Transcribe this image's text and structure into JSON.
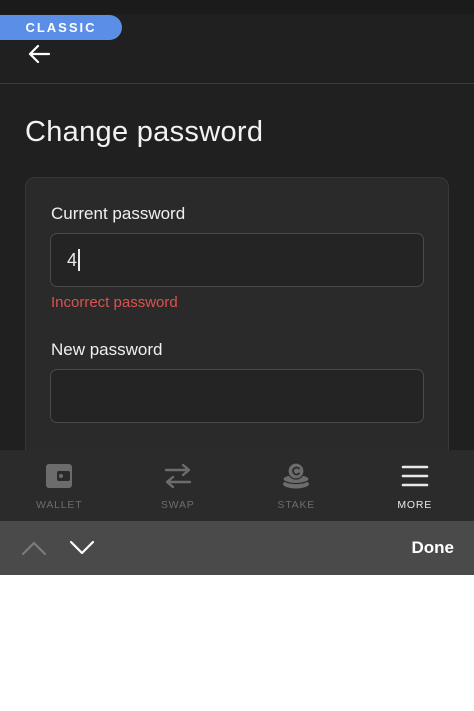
{
  "badge": {
    "label": "CLASSIC"
  },
  "header": {
    "back_icon": "arrow-left-icon"
  },
  "page": {
    "title": "Change password"
  },
  "form": {
    "current_label": "Current password",
    "current_value": "4",
    "error": "Incorrect password",
    "new_label": "New password",
    "new_value": ""
  },
  "nav": {
    "items": [
      {
        "label": "WALLET",
        "icon": "wallet-icon",
        "active": false
      },
      {
        "label": "SWAP",
        "icon": "swap-arrows-icon",
        "active": false
      },
      {
        "label": "STAKE",
        "icon": "coin-stack-icon",
        "active": false
      },
      {
        "label": "MORE",
        "icon": "menu-icon",
        "active": true
      }
    ]
  },
  "keyboard_toolbar": {
    "done_label": "Done"
  },
  "colors": {
    "background": "#202020",
    "card": "#2a2a2a",
    "badge": "#5b8ee6",
    "error": "#d9534f"
  }
}
